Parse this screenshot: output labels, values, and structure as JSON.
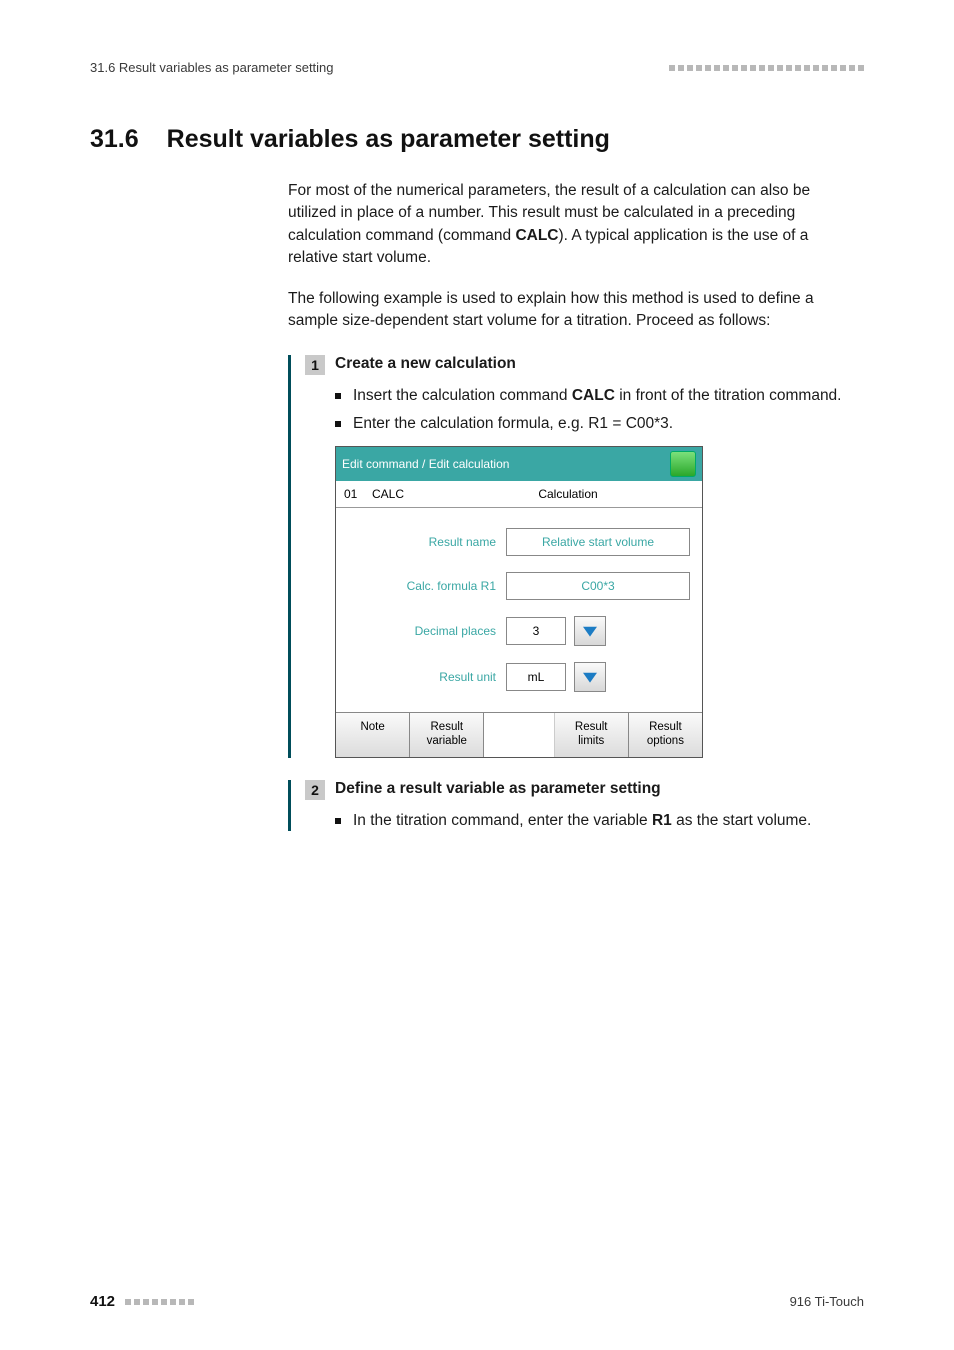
{
  "running_header": {
    "left": "31.6 Result variables as parameter setting"
  },
  "heading": {
    "number": "31.6",
    "title": "Result variables as parameter setting"
  },
  "paragraphs": {
    "p1_pre": "For most of the numerical parameters, the result of a calculation can also be utilized in place of a number. This result must be calculated in a preceding calculation command (command ",
    "p1_bold": "CALC",
    "p1_post": "). A typical application is the use of a relative start volume.",
    "p2": "The following example is used to explain how this method is used to define a sample size-dependent start volume for a titration. Proceed as follows:"
  },
  "step1": {
    "number": "1",
    "title": "Create a new calculation",
    "b1_pre": "Insert the calculation command ",
    "b1_bold": "CALC",
    "b1_post": " in front of the titration command.",
    "b2": "Enter the calculation formula, e.g. R1 = C00*3."
  },
  "device": {
    "title": "Edit command / Edit calculation",
    "tab_index": "01",
    "tab_cmd": "CALC",
    "tab_name": "Calculation",
    "fields": {
      "result_name_label": "Result name",
      "result_name_value": "Relative start volume",
      "calc_formula_label": "Calc. formula R1",
      "calc_formula_value": "C00*3",
      "decimal_places_label": "Decimal places",
      "decimal_places_value": "3",
      "result_unit_label": "Result unit",
      "result_unit_value": "mL"
    },
    "buttons": {
      "note": "Note",
      "result_variable": "Result variable",
      "result_limits": "Result limits",
      "result_options": "Result options"
    }
  },
  "step2": {
    "number": "2",
    "title": "Define a result variable as parameter setting",
    "b1_pre": "In the titration command, enter the variable ",
    "b1_bold": "R1",
    "b1_post": " as the start volume."
  },
  "footer": {
    "page_number": "412",
    "product": "916 Ti-Touch"
  }
}
